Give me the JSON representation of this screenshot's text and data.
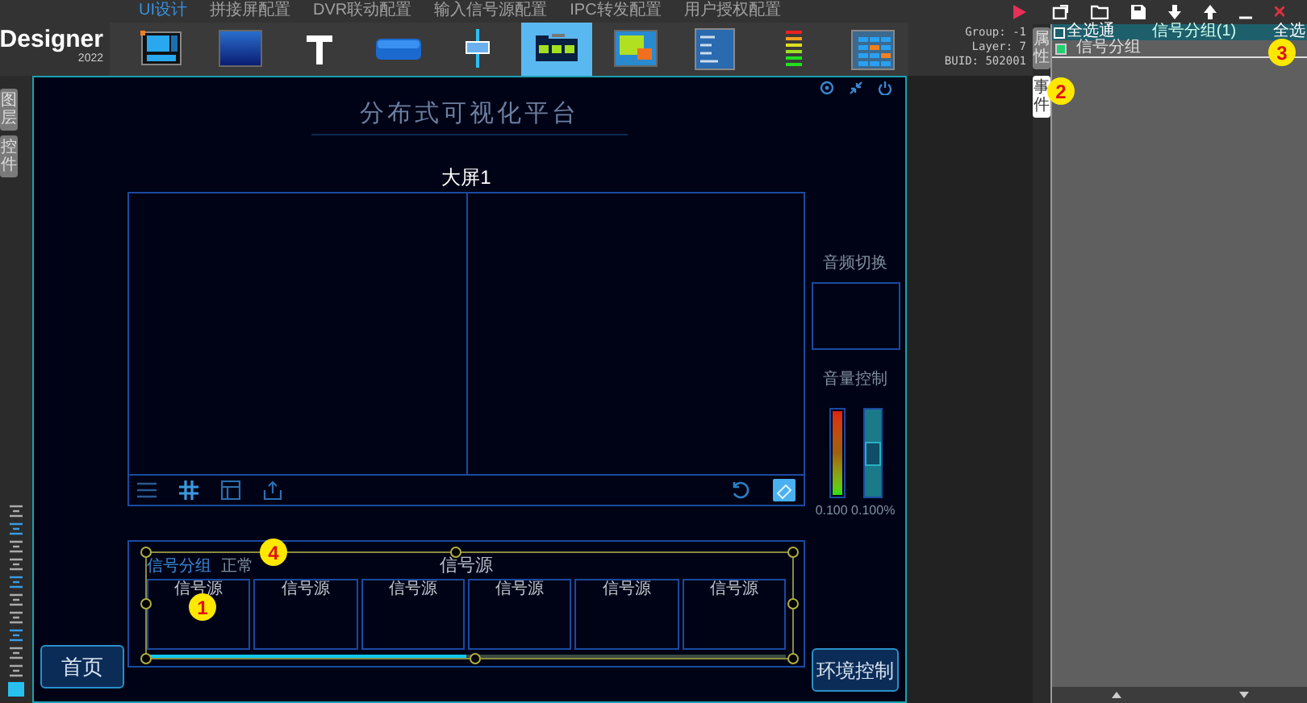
{
  "app": {
    "name": "Designer",
    "version": "2022"
  },
  "tabs": [
    {
      "label": "UI设计",
      "selected": true
    },
    {
      "label": "拼接屏配置",
      "selected": false
    },
    {
      "label": "DVR联动配置",
      "selected": false
    },
    {
      "label": "输入信号源配置",
      "selected": false
    },
    {
      "label": "IPC转发配置",
      "selected": false
    },
    {
      "label": "用户授权配置",
      "selected": false
    }
  ],
  "toolbar": [
    {
      "kind": "layout",
      "selected": false
    },
    {
      "kind": "gradient",
      "selected": false
    },
    {
      "kind": "text",
      "selected": false
    },
    {
      "kind": "button",
      "selected": false
    },
    {
      "kind": "slider",
      "selected": false
    },
    {
      "kind": "group",
      "selected": true
    },
    {
      "kind": "window",
      "selected": false
    },
    {
      "kind": "textlist",
      "selected": false
    },
    {
      "kind": "meter",
      "selected": false
    },
    {
      "kind": "matrix",
      "selected": false
    }
  ],
  "info": [
    "Group: -1",
    "Layer: 7",
    "BUID: 502001"
  ],
  "left_tabs": [
    {
      "label": "图层",
      "selected": false
    },
    {
      "label": "控件",
      "selected": false
    }
  ],
  "right_tabs": [
    {
      "label": "属性",
      "selected": false
    },
    {
      "label": "事件",
      "selected": true
    }
  ],
  "panel": {
    "select_all": {
      "label": "全选通",
      "checked": false
    },
    "title": "信号分组(1)",
    "select_all_right": "全选",
    "rows": [
      {
        "label": "信号分组",
        "checked": true
      }
    ]
  },
  "canvas": {
    "title": "分布式可视化平台",
    "screen_title": "大屏1",
    "audio_label": "音频切换",
    "volume_label": "音量控制",
    "meter": {
      "level": 1
    },
    "volume": {
      "level": 0.5
    },
    "volume_reading": "0.100 0.100%",
    "group": {
      "title": "信号源",
      "name": "信号分组",
      "status": "正常",
      "cells": [
        "信号源",
        "信号源",
        "信号源",
        "信号源",
        "信号源",
        "信号源"
      ],
      "level": 0.5
    },
    "home_button": "首页",
    "env_button": "环境控制"
  },
  "annotations": [
    "1",
    "2",
    "3",
    "4"
  ]
}
